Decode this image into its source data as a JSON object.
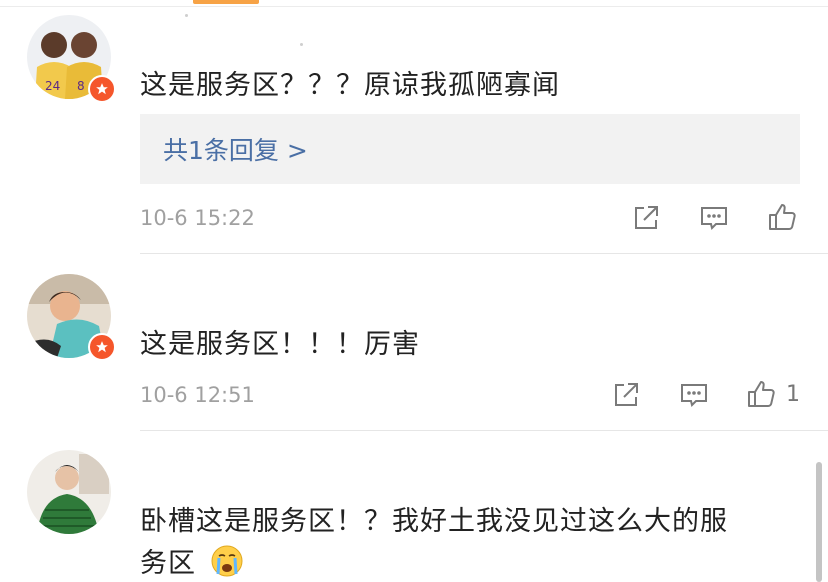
{
  "comments": [
    {
      "text": "这是服务区？？？原谅我孤陋寡闻",
      "reply_link": "共1条回复 >",
      "time": "10-6 15:22",
      "icons": [
        "share-icon",
        "comment-icon",
        "like-icon"
      ],
      "like_count": ""
    },
    {
      "text": "这是服务区！！！厉害",
      "time": "10-6 12:51",
      "icons": [
        "share-icon",
        "comment-icon",
        "like-icon"
      ],
      "like_count": "1"
    },
    {
      "text_line1": "卧槽这是服务区！？我好土我没见过这么大的服",
      "text_line2": "务区",
      "emoji": "crying-face-emoji"
    }
  ],
  "colors": {
    "link": "#4a6fa5",
    "badge": "#f5562b",
    "accent_tab": "#f7a346"
  }
}
